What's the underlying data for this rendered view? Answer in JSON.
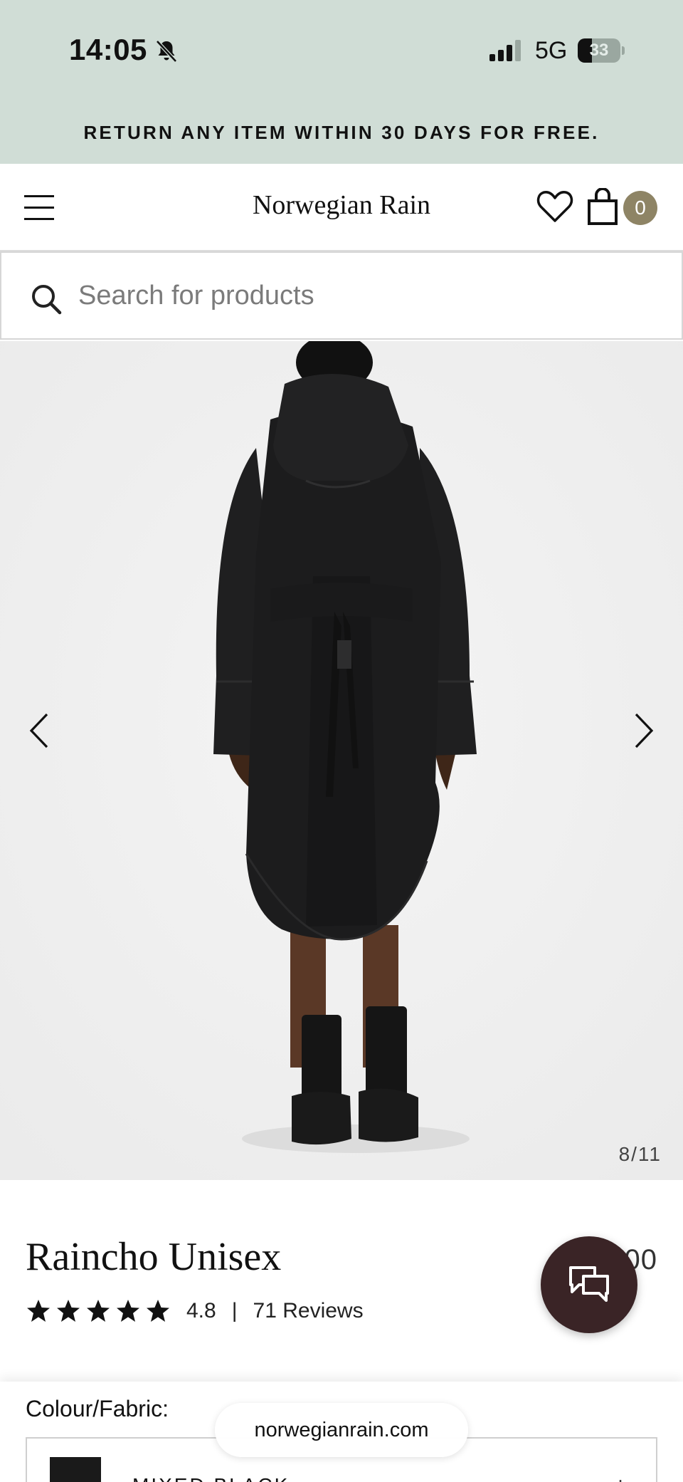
{
  "status_bar": {
    "time": "14:05",
    "network": "5G",
    "battery_level": "33",
    "battery_percent": 33
  },
  "promo": {
    "text": "RETURN ANY ITEM WITHIN 30 DAYS FOR FREE."
  },
  "header": {
    "brand": "Norwegian Rain",
    "cart_count": "0"
  },
  "search": {
    "placeholder": "Search for products"
  },
  "gallery": {
    "counter": "8/11"
  },
  "product": {
    "title": "Raincho Unisex",
    "price_visible": "NO 00",
    "rating": "4.8",
    "stars": 5,
    "separator": "|",
    "reviews": "71 Reviews"
  },
  "options": {
    "colour_label": "Colour/Fabric:",
    "selected_fabric": "MIXED BLACK",
    "expand_symbol": "+"
  },
  "browser": {
    "url": "norwegianrain.com"
  },
  "colors": {
    "promo_bg": "#d0ddd6",
    "cart_badge": "#8e8465",
    "chat_button": "#3a2426",
    "coat": "#1c1c1d"
  }
}
